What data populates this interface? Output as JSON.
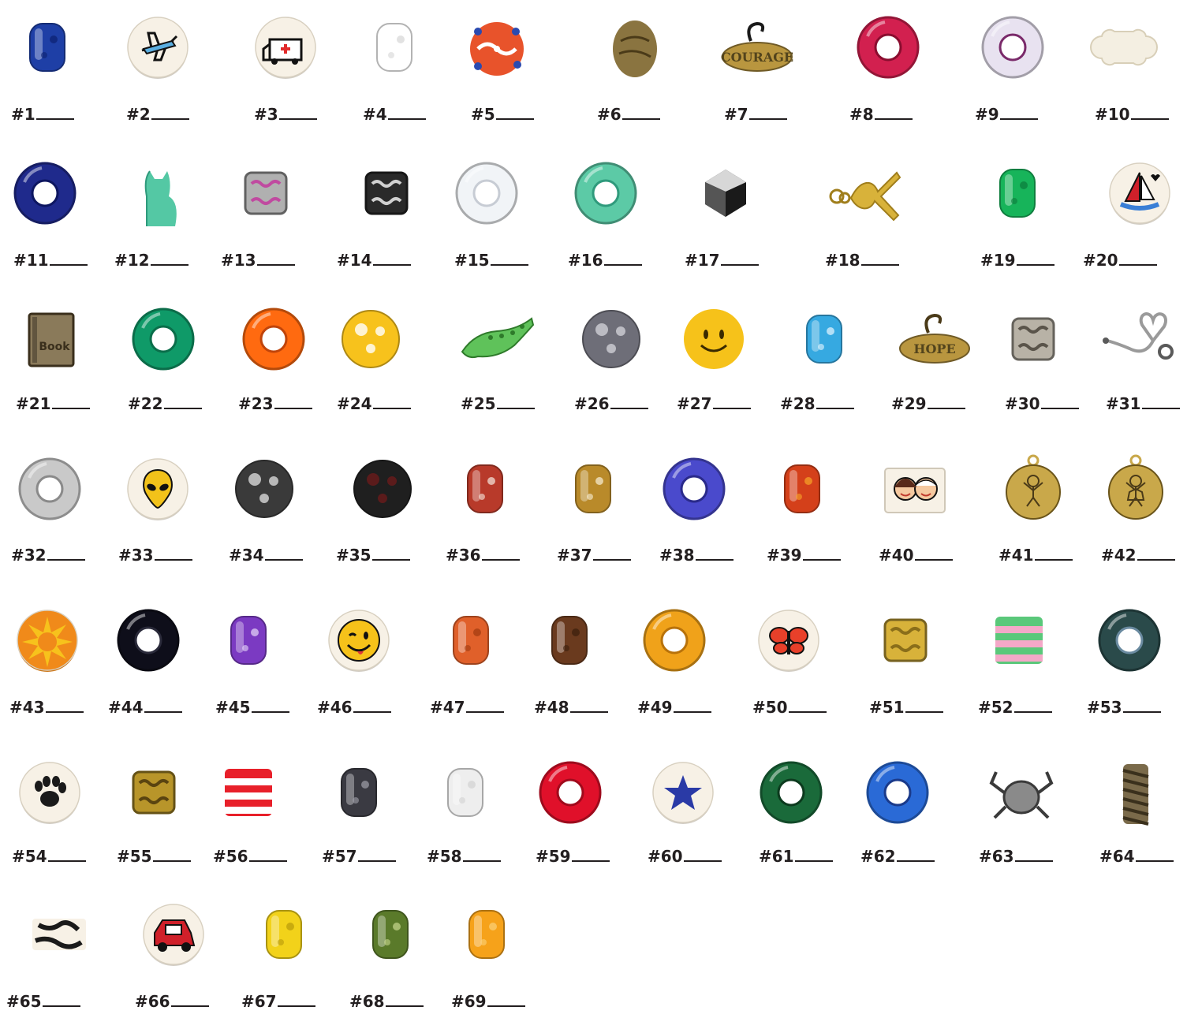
{
  "beads": [
    {
      "label": "#1",
      "shape": "barrel",
      "color": "#1e3fa6",
      "accent": "#0c2170"
    },
    {
      "label": "#2",
      "shape": "disc",
      "color": "#f7f1e6",
      "accent": "#5aaee0",
      "motif": "airplane"
    },
    {
      "label": "#3",
      "shape": "disc",
      "color": "#f7f1e6",
      "accent": "#e22b2b",
      "motif": "ambulance"
    },
    {
      "label": "#4",
      "shape": "barrel",
      "color": "#ffffff",
      "accent": "#d6d6d6"
    },
    {
      "label": "#5",
      "shape": "lampwork",
      "color": "#e8532b",
      "accent": "#ffffff"
    },
    {
      "label": "#6",
      "shape": "nugget",
      "color": "#8a7440",
      "accent": "#4a3a18"
    },
    {
      "label": "#7",
      "shape": "charm",
      "color": "#b9963f",
      "accent": "#1a1a1a",
      "text": "COURAGE"
    },
    {
      "label": "#8",
      "shape": "ring",
      "color": "#d2204f",
      "accent": "#8a0d2f"
    },
    {
      "label": "#9",
      "shape": "ring",
      "color": "#e8e2f0",
      "accent": "#7a2a6a"
    },
    {
      "label": "#10",
      "shape": "bone",
      "color": "#f4efe2",
      "accent": "#d8cfb8"
    },
    {
      "label": "#11",
      "shape": "ring",
      "color": "#1f2a8c",
      "accent": "#0d1660"
    },
    {
      "label": "#12",
      "shape": "cat",
      "color": "#54c8a4",
      "accent": "#2f9a7c"
    },
    {
      "label": "#13",
      "shape": "metal",
      "color": "#b0b0b0",
      "accent": "#c04aa0"
    },
    {
      "label": "#14",
      "shape": "metal",
      "color": "#2a2a2a",
      "accent": "#d0d0d0"
    },
    {
      "label": "#15",
      "shape": "ring",
      "color": "#f1f4f7",
      "accent": "#c7ccd4"
    },
    {
      "label": "#16",
      "shape": "ring",
      "color": "#5ccaa6",
      "accent": "#2f9a7c"
    },
    {
      "label": "#17",
      "shape": "gem",
      "color": "#1a1a1a",
      "accent": "#d7d7d7"
    },
    {
      "label": "#18",
      "shape": "ribbon",
      "color": "#d8b23a",
      "accent": "#a07e1c"
    },
    {
      "label": "#19",
      "shape": "barrel",
      "color": "#17b45a",
      "accent": "#0c7a3b"
    },
    {
      "label": "#20",
      "shape": "disc",
      "color": "#f7f1e6",
      "accent": "#3a7fd6",
      "motif": "sailboat"
    },
    {
      "label": "#21",
      "shape": "book",
      "color": "#8a7a5a",
      "accent": "#3a2f1c",
      "text": "Book"
    },
    {
      "label": "#22",
      "shape": "ring",
      "color": "#0f9a68",
      "accent": "#0a6e4a"
    },
    {
      "label": "#23",
      "shape": "ring",
      "color": "#ff6a10",
      "accent": "#c0440a"
    },
    {
      "label": "#24",
      "shape": "round",
      "color": "#f7c21c",
      "accent": "#ffffff"
    },
    {
      "label": "#25",
      "shape": "gator",
      "color": "#5fc25a",
      "accent": "#2e7a2a"
    },
    {
      "label": "#26",
      "shape": "round",
      "color": "#6e6e78",
      "accent": "#cfcfd6"
    },
    {
      "label": "#27",
      "shape": "smiley",
      "color": "#f6c21a",
      "accent": "#3a2a00"
    },
    {
      "label": "#28",
      "shape": "barrel",
      "color": "#36a9e1",
      "accent": "#e8f6ff"
    },
    {
      "label": "#29",
      "shape": "charm",
      "color": "#b9963f",
      "accent": "#4a3a18",
      "text": "HOPE"
    },
    {
      "label": "#30",
      "shape": "metal",
      "color": "#b8b2a6",
      "accent": "#5a544a"
    },
    {
      "label": "#31",
      "shape": "stethoscope",
      "color": "#9a9a9a",
      "accent": "#5a5a5a"
    },
    {
      "label": "#32",
      "shape": "ring",
      "color": "#c9c9c9",
      "accent": "#8a8a8a"
    },
    {
      "label": "#33",
      "shape": "disc",
      "color": "#f7f1e6",
      "accent": "#f2c21a",
      "motif": "alien"
    },
    {
      "label": "#34",
      "shape": "round",
      "color": "#3a3a3a",
      "accent": "#d8d8d8"
    },
    {
      "label": "#35",
      "shape": "round",
      "color": "#1f1f1f",
      "accent": "#6a1a1a"
    },
    {
      "label": "#36",
      "shape": "barrel",
      "color": "#b83a2a",
      "accent": "#f5e9e0"
    },
    {
      "label": "#37",
      "shape": "barrel",
      "color": "#b98a2a",
      "accent": "#f8f0d8"
    },
    {
      "label": "#38",
      "shape": "ring",
      "color": "#4a4acc",
      "accent": "#2a2a8a"
    },
    {
      "label": "#39",
      "shape": "barrel",
      "color": "#d4401a",
      "accent": "#f6a52a"
    },
    {
      "label": "#40",
      "shape": "tile",
      "color": "#f7f1e6",
      "accent": "#c0392b",
      "motif": "kids"
    },
    {
      "label": "#41",
      "shape": "medal",
      "color": "#c9a84a",
      "accent": "#6a541a",
      "motif": "boy"
    },
    {
      "label": "#42",
      "shape": "medal",
      "color": "#c9a84a",
      "accent": "#6a541a",
      "motif": "girl"
    },
    {
      "label": "#43",
      "shape": "disc",
      "color": "#f08a1a",
      "accent": "#f7c21c",
      "motif": "sun"
    },
    {
      "label": "#44",
      "shape": "ring",
      "color": "#0e0e1a",
      "accent": "#2a2a3a"
    },
    {
      "label": "#45",
      "shape": "barrel",
      "color": "#7b3ac2",
      "accent": "#e8d8f8"
    },
    {
      "label": "#46",
      "shape": "disc",
      "color": "#f7f1e6",
      "accent": "#f6c21a",
      "motif": "wink"
    },
    {
      "label": "#47",
      "shape": "barrel",
      "color": "#e0602a",
      "accent": "#a03a10"
    },
    {
      "label": "#48",
      "shape": "barrel",
      "color": "#6a3a1e",
      "accent": "#3a1e0c"
    },
    {
      "label": "#49",
      "shape": "ring",
      "color": "#f0a21a",
      "accent": "#b8720a"
    },
    {
      "label": "#50",
      "shape": "disc",
      "color": "#f7f1e6",
      "accent": "#f6c21a",
      "motif": "butterfly"
    },
    {
      "label": "#51",
      "shape": "metal",
      "color": "#d8b23a",
      "accent": "#8a6e1a"
    },
    {
      "label": "#52",
      "shape": "stripes",
      "color": "#5ac87a",
      "accent": "#f4a8c8"
    },
    {
      "label": "#53",
      "shape": "ring",
      "color": "#2a4a4a",
      "accent": "#6a8aa0"
    },
    {
      "label": "#54",
      "shape": "disc",
      "color": "#f7f1e6",
      "accent": "#1a1a1a",
      "motif": "paw"
    },
    {
      "label": "#55",
      "shape": "metal",
      "color": "#b8952a",
      "accent": "#5a4410"
    },
    {
      "label": "#56",
      "shape": "stripes",
      "color": "#e8202a",
      "accent": "#ffffff"
    },
    {
      "label": "#57",
      "shape": "barrel",
      "color": "#3a3a42",
      "accent": "#a0a0aa"
    },
    {
      "label": "#58",
      "shape": "barrel",
      "color": "#eeeeee",
      "accent": "#d2d2d2"
    },
    {
      "label": "#59",
      "shape": "ring",
      "color": "#e0102a",
      "accent": "#a00a1c"
    },
    {
      "label": "#60",
      "shape": "disc",
      "color": "#f7f1e6",
      "accent": "#2a3aa6",
      "motif": "star"
    },
    {
      "label": "#61",
      "shape": "ring",
      "color": "#1a6a3a",
      "accent": "#0c3a1e"
    },
    {
      "label": "#62",
      "shape": "ring",
      "color": "#2a6ad6",
      "accent": "#1a3a8a"
    },
    {
      "label": "#63",
      "shape": "crab",
      "color": "#8a8a8a",
      "accent": "#3a3a3a"
    },
    {
      "label": "#64",
      "shape": "coil",
      "color": "#7a6a4a",
      "accent": "#3a301c"
    },
    {
      "label": "#65",
      "shape": "zebra",
      "color": "#f7f1e6",
      "accent": "#1a1a1a"
    },
    {
      "label": "#66",
      "shape": "disc",
      "color": "#f7f1e6",
      "accent": "#d0202a",
      "motif": "car"
    },
    {
      "label": "#67",
      "shape": "barrel",
      "color": "#f2d21a",
      "accent": "#b89a0a"
    },
    {
      "label": "#68",
      "shape": "barrel",
      "color": "#5a7a2a",
      "accent": "#c8d890"
    },
    {
      "label": "#69",
      "shape": "barrel",
      "color": "#f6a21a",
      "accent": "#fbd27a"
    }
  ]
}
